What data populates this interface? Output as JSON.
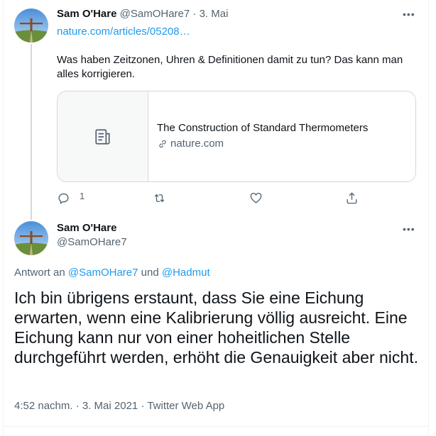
{
  "tweet1": {
    "display_name": "Sam O'Hare",
    "handle": "@SamOHare7",
    "separator": "·",
    "date": "3. Mai",
    "link_text": "nature.com/articles/05208…",
    "text": "Was haben Zeitzonen, Uhren & Definitionen damit zu tun? Das kann man alles korrigieren.",
    "card": {
      "title": "The Construction of Standard Thermometers",
      "domain": "nature.com"
    },
    "actions": {
      "reply_count": "1"
    }
  },
  "tweet2": {
    "display_name": "Sam O'Hare",
    "handle": "@SamOHare7",
    "reply_prefix": "Antwort an",
    "reply_to_1": "@SamOHare7",
    "reply_and": "und",
    "reply_to_2": "@Hadmut",
    "text": "Ich bin übrigens erstaunt, dass Sie eine Eichung erwarten, wenn eine Kalibrierung völlig ausreicht. Eine Eichung kann nur von einer hoheitlichen Stelle durchgeführt werden, erhöht die Genauigkeit aber nicht.",
    "meta": "4:52 nachm. · 3. Mai 2021 · Twitter Web App"
  },
  "icons": [
    "more-icon",
    "link-icon",
    "article-icon",
    "reply-icon",
    "retweet-icon",
    "like-icon",
    "share-icon"
  ],
  "colors": {
    "accent": "#1d9bf0",
    "muted": "#536471",
    "border": "#cfd9de"
  }
}
